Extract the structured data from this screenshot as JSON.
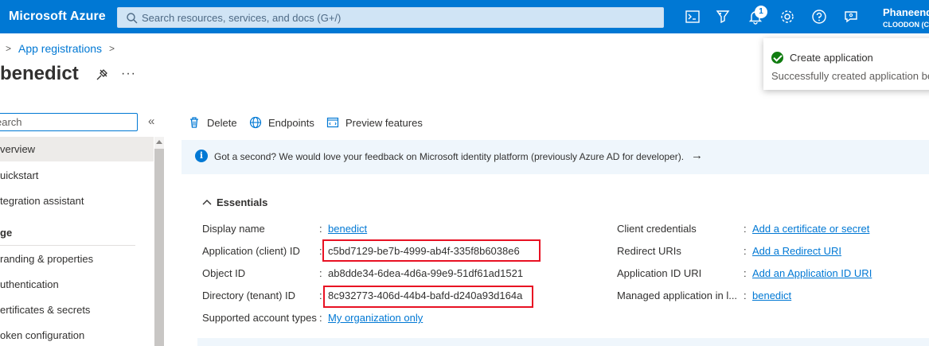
{
  "header": {
    "brand": "Microsoft Azure",
    "search_placeholder": "Search resources, services, and docs (G+/)",
    "notification_count": "1",
    "user_name": "Phaneend",
    "user_tenant": "CLOODON (C",
    "icons": [
      "cloud-shell-icon",
      "directory-filter-icon",
      "notifications-icon",
      "settings-icon",
      "help-icon",
      "feedback-icon"
    ]
  },
  "breadcrumb": {
    "items": [
      "App registrations"
    ]
  },
  "page": {
    "title": "benedict",
    "more": "···"
  },
  "nav": {
    "search_placeholder": "earch",
    "collapse": "«",
    "items": [
      {
        "label": "verview",
        "active": true
      },
      {
        "label": "uickstart"
      },
      {
        "label": "tegration assistant"
      }
    ],
    "section": "ge",
    "manage_items": [
      {
        "label": "randing & properties"
      },
      {
        "label": "uthentication"
      },
      {
        "label": "ertificates & secrets"
      },
      {
        "label": "oken configuration"
      }
    ]
  },
  "commands": {
    "delete": "Delete",
    "endpoints": "Endpoints",
    "preview": "Preview features"
  },
  "banner": {
    "text": "Got a second? We would love your feedback on Microsoft identity platform (previously Azure AD for developer).",
    "arrow": "→"
  },
  "essentials": {
    "title": "Essentials",
    "left": [
      {
        "key": "Display name",
        "value": "benedict",
        "link": true
      },
      {
        "key": "Application (client) ID",
        "value": "c5bd7129-be7b-4999-ab4f-335f8b6038e6",
        "link": false
      },
      {
        "key": "Object ID",
        "value": "ab8dde34-6dea-4d6a-99e9-51df61ad1521",
        "link": false
      },
      {
        "key": "Directory (tenant) ID",
        "value": "8c932773-406d-44b4-bafd-d240a93d164a",
        "link": false
      },
      {
        "key": "Supported account types",
        "value": "My organization only",
        "link": true
      }
    ],
    "right": [
      {
        "key": "Client credentials",
        "value": "Add a certificate or secret",
        "link": true
      },
      {
        "key": "Redirect URIs",
        "value": "Add a Redirect URI",
        "link": true
      },
      {
        "key": "Application ID URI",
        "value": "Add an Application ID URI",
        "link": true
      },
      {
        "key": "Managed application in l...",
        "value": "benedict",
        "link": true
      }
    ]
  },
  "toast": {
    "title": "Create application",
    "body": "Successfully created application be"
  },
  "colors": {
    "azure_blue": "#0078d4",
    "highlight_red": "#e81123",
    "success_green": "#107c10"
  }
}
